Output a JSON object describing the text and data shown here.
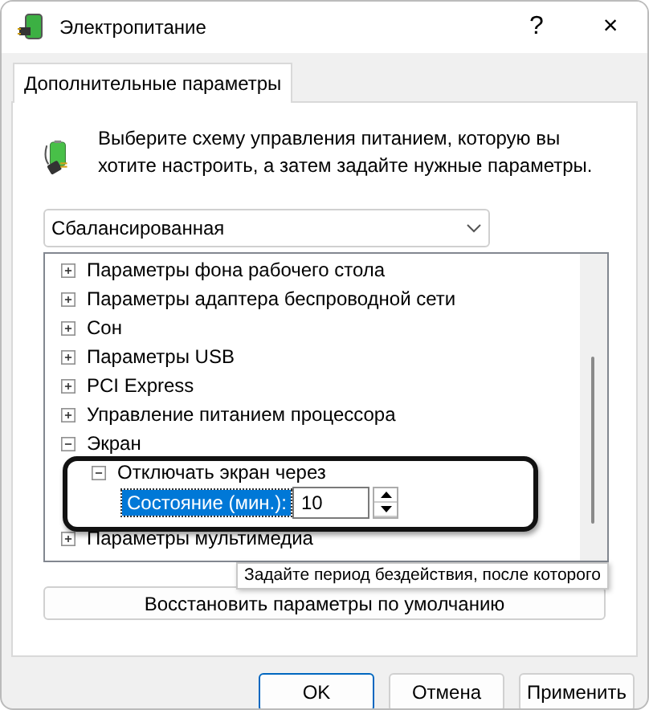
{
  "window": {
    "title": "Электропитание",
    "help": "?",
    "close": "×"
  },
  "tabs": [
    {
      "label": "Дополнительные параметры",
      "selected": true
    }
  ],
  "description": "Выберите схему управления питанием, которую вы хотите настроить, а затем задайте нужные параметры.",
  "plan_select": {
    "value": "Сбалансированная"
  },
  "tree": [
    {
      "label": "Параметры фона рабочего стола",
      "expanded": false
    },
    {
      "label": "Параметры адаптера беспроводной сети",
      "expanded": false
    },
    {
      "label": "Сон",
      "expanded": false
    },
    {
      "label": "Параметры USB",
      "expanded": false
    },
    {
      "label": "PCI Express",
      "expanded": false
    },
    {
      "label": "Управление питанием процессора",
      "expanded": false
    },
    {
      "label": "Экран",
      "expanded": true,
      "children": [
        {
          "label": "Отключать экран через",
          "expanded": true,
          "children": [
            {
              "kind": "setting",
              "label": "Состояние (мин.):",
              "selected": true,
              "value": "10"
            }
          ]
        }
      ]
    },
    {
      "label": "Параметры мультимедиа",
      "expanded": false
    }
  ],
  "restore_button": "Восстановить параметры по умолчанию",
  "tooltip": "Задайте период бездействия, после которого",
  "buttons": [
    {
      "label": "OK",
      "default": true
    },
    {
      "label": "Отмена",
      "default": false
    },
    {
      "label": "Применить",
      "default": false
    }
  ]
}
